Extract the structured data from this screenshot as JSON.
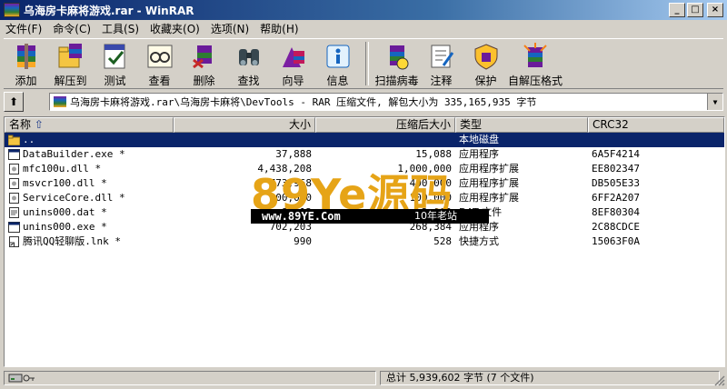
{
  "window": {
    "title": "乌海房卡麻将游戏.rar - WinRAR",
    "buttons": [
      "_",
      "□",
      "×"
    ]
  },
  "menu": [
    "文件(F)",
    "命令(C)",
    "工具(S)",
    "收藏夹(O)",
    "选项(N)",
    "帮助(H)"
  ],
  "toolbar": {
    "group1": [
      {
        "label": "添加",
        "icon": "add-archive-icon"
      },
      {
        "label": "解压到",
        "icon": "extract-to-icon"
      },
      {
        "label": "测试",
        "icon": "test-icon"
      },
      {
        "label": "查看",
        "icon": "view-icon"
      },
      {
        "label": "删除",
        "icon": "delete-icon"
      },
      {
        "label": "查找",
        "icon": "find-icon"
      },
      {
        "label": "向导",
        "icon": "wizard-icon"
      },
      {
        "label": "信息",
        "icon": "info-icon"
      }
    ],
    "group2": [
      {
        "label": "扫描病毒",
        "icon": "virus-scan-icon"
      },
      {
        "label": "注释",
        "icon": "comment-icon"
      },
      {
        "label": "保护",
        "icon": "protect-icon"
      },
      {
        "label": "自解压格式",
        "icon": "sfx-icon"
      }
    ]
  },
  "address": {
    "text": "乌海房卡麻将游戏.rar\\乌海房卡麻将\\DevTools - RAR 压缩文件, 解包大小为 335,165,935 字节"
  },
  "columns": {
    "name": "名称",
    "size": "大小",
    "packed": "压缩后大小",
    "type": "类型",
    "crc": "CRC32"
  },
  "files": [
    {
      "name": "..",
      "size": "",
      "packed": "",
      "type": "本地磁盘",
      "crc": "",
      "icon": "folder-up-icon",
      "selected": true
    },
    {
      "name": "DataBuilder.exe *",
      "size": "37,888",
      "packed": "15,088",
      "type": "应用程序",
      "crc": "6A5F4214",
      "icon": "exe-icon"
    },
    {
      "name": "mfc100u.dll *",
      "size": "4,438,208",
      "packed": "1,000,000",
      "type": "应用程序扩展",
      "crc": "EE802347",
      "icon": "dll-icon"
    },
    {
      "name": "msvcr100.dll *",
      "size": "773,968",
      "packed": "400,000",
      "type": "应用程序扩展",
      "crc": "DB505E33",
      "icon": "dll-icon"
    },
    {
      "name": "ServiceCore.dll *",
      "size": "400,000",
      "packed": "100,000",
      "type": "应用程序扩展",
      "crc": "6FF2A207",
      "icon": "dll-icon"
    },
    {
      "name": "unins000.dat *",
      "size": "8,112",
      "packed": "2,000",
      "type": "DAT 文件",
      "crc": "8EF80304",
      "icon": "dat-icon"
    },
    {
      "name": "unins000.exe *",
      "size": "702,203",
      "packed": "268,384",
      "type": "应用程序",
      "crc": "2C88CDCE",
      "icon": "exe-icon"
    },
    {
      "name": "腾讯QQ轻聊版.lnk *",
      "size": "990",
      "packed": "528",
      "type": "快捷方式",
      "crc": "15063F0A",
      "icon": "shortcut-icon"
    }
  ],
  "status": {
    "total": "总计 5,939,602 字节 (7 个文件)"
  },
  "watermark": {
    "big": "89Ye源码",
    "url": "www.89YE.Com",
    "tag": "10年老站"
  }
}
